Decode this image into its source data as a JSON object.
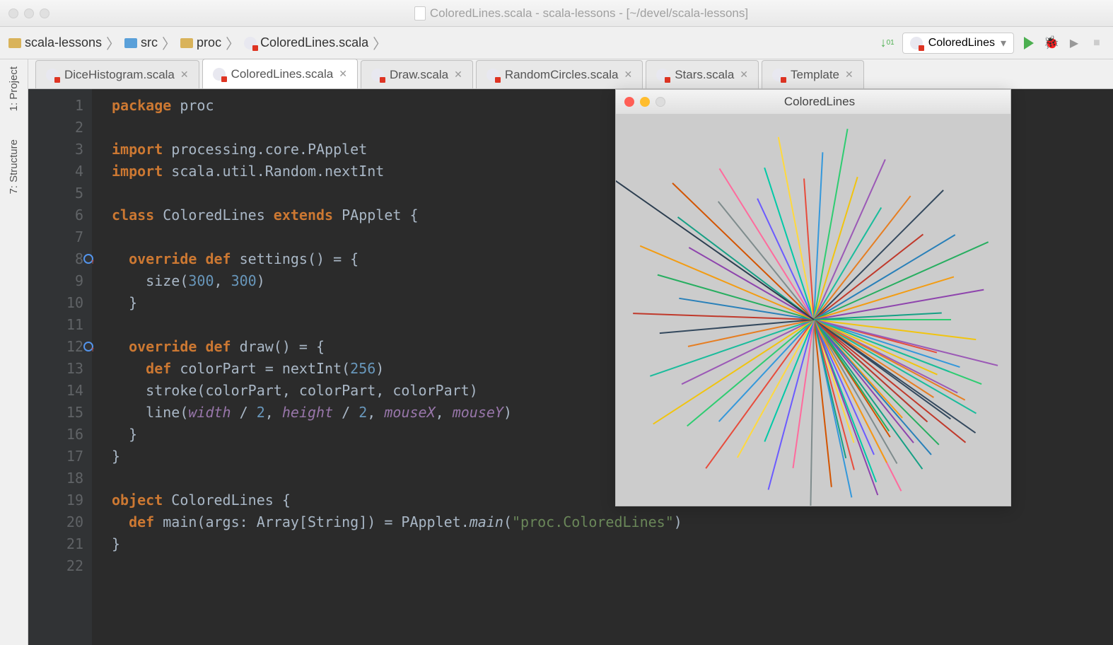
{
  "window_title": "ColoredLines.scala - scala-lessons - [~/devel/scala-lessons]",
  "breadcrumbs": [
    {
      "label": "scala-lessons",
      "icon": "folder"
    },
    {
      "label": "src",
      "icon": "folder-blue"
    },
    {
      "label": "proc",
      "icon": "folder"
    },
    {
      "label": "ColoredLines.scala",
      "icon": "scala"
    }
  ],
  "run_config": "ColoredLines",
  "sidebar_tabs": [
    {
      "label": "1: Project"
    },
    {
      "label": "7: Structure"
    }
  ],
  "editor_tabs": [
    {
      "label": "DiceHistogram.scala",
      "active": false
    },
    {
      "label": "ColoredLines.scala",
      "active": true
    },
    {
      "label": "Draw.scala",
      "active": false
    },
    {
      "label": "RandomCircles.scala",
      "active": false
    },
    {
      "label": "Stars.scala",
      "active": false
    },
    {
      "label": "Template",
      "active": false
    }
  ],
  "code": {
    "line_count": 22,
    "tokens": [
      [
        [
          "kw",
          "package"
        ],
        [
          "ident",
          " proc"
        ]
      ],
      [],
      [
        [
          "kw",
          "import"
        ],
        [
          "ident",
          " processing.core.PApplet"
        ]
      ],
      [
        [
          "kw",
          "import"
        ],
        [
          "ident",
          " scala.util.Random.nextInt"
        ]
      ],
      [],
      [
        [
          "kw",
          "class"
        ],
        [
          "ident",
          " ColoredLines "
        ],
        [
          "kw",
          "extends"
        ],
        [
          "ident",
          " PApplet {"
        ]
      ],
      [],
      [
        [
          "ident",
          "  "
        ],
        [
          "kw",
          "override def"
        ],
        [
          "ident",
          " settings() = {"
        ]
      ],
      [
        [
          "ident",
          "    size("
        ],
        [
          "num",
          "300"
        ],
        [
          "ident",
          ", "
        ],
        [
          "num",
          "300"
        ],
        [
          "ident",
          ")"
        ]
      ],
      [
        [
          "ident",
          "  }"
        ]
      ],
      [],
      [
        [
          "ident",
          "  "
        ],
        [
          "kw",
          "override def"
        ],
        [
          "ident",
          " draw() = {"
        ]
      ],
      [
        [
          "ident",
          "    "
        ],
        [
          "kw",
          "def"
        ],
        [
          "ident",
          " colorPart = nextInt("
        ],
        [
          "num",
          "256"
        ],
        [
          "ident",
          ")"
        ]
      ],
      [
        [
          "ident",
          "    stroke(colorPart, colorPart, colorPart)"
        ]
      ],
      [
        [
          "ident",
          "    line("
        ],
        [
          "param",
          "width"
        ],
        [
          "ident",
          " / "
        ],
        [
          "num",
          "2"
        ],
        [
          "ident",
          ", "
        ],
        [
          "param",
          "height"
        ],
        [
          "ident",
          " / "
        ],
        [
          "num",
          "2"
        ],
        [
          "ident",
          ", "
        ],
        [
          "param",
          "mouseX"
        ],
        [
          "ident",
          ", "
        ],
        [
          "param",
          "mouseY"
        ],
        [
          "ident",
          ")"
        ]
      ],
      [
        [
          "ident",
          "  }"
        ]
      ],
      [
        [
          "ident",
          "}"
        ]
      ],
      [],
      [
        [
          "kw",
          "object"
        ],
        [
          "ident",
          " ColoredLines {"
        ]
      ],
      [
        [
          "ident",
          "  "
        ],
        [
          "kw",
          "def"
        ],
        [
          "ident",
          " main(args: Array["
        ],
        [
          "type",
          "String"
        ],
        [
          "ident",
          "]) = PApplet."
        ],
        [
          "italic",
          "main"
        ],
        [
          "ident",
          "("
        ],
        [
          "str",
          "\"proc.ColoredLines\""
        ],
        [
          "ident",
          ")"
        ]
      ],
      [
        [
          "ident",
          "}"
        ]
      ],
      []
    ],
    "override_markers": [
      8,
      12
    ],
    "fold_markers": [
      1,
      3,
      4,
      6,
      8,
      10,
      12,
      16,
      17,
      19,
      21
    ]
  },
  "preview": {
    "title": "ColoredLines",
    "colors": [
      "#e74c3c",
      "#3498db",
      "#2ecc71",
      "#f1c40f",
      "#9b59b6",
      "#1abc9c",
      "#e67e22",
      "#34495e",
      "#c0392b",
      "#2980b9",
      "#27ae60",
      "#f39c12",
      "#8e44ad",
      "#16a085",
      "#d35400",
      "#7f8c8d",
      "#ff6b9d",
      "#6b5bff",
      "#00c9a7",
      "#ffd93d"
    ]
  }
}
